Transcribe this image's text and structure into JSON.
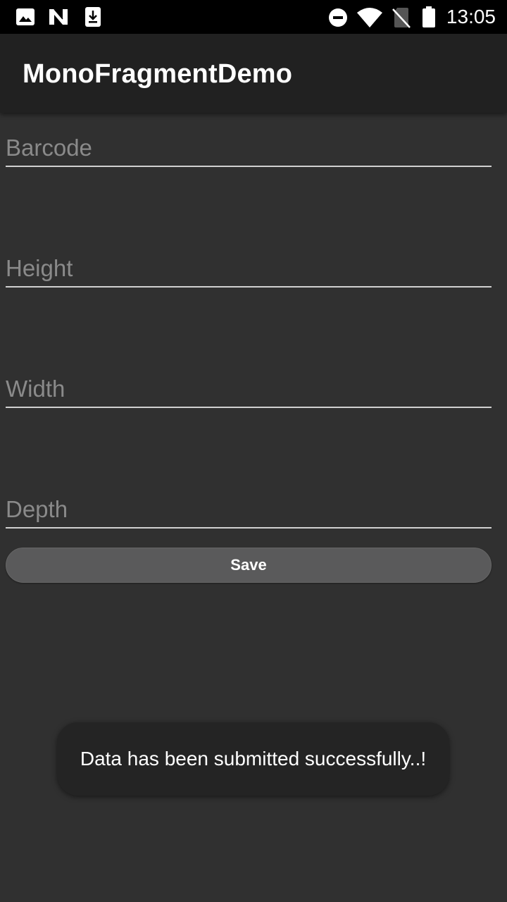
{
  "status_bar": {
    "time": "13:05",
    "left_icons": [
      "image-icon",
      "n-icon",
      "download-icon"
    ],
    "right_icons": [
      "do-not-disturb-icon",
      "wifi-icon",
      "no-sim-icon",
      "battery-icon"
    ]
  },
  "app_bar": {
    "title": "MonoFragmentDemo"
  },
  "form": {
    "barcode": {
      "placeholder": "Barcode",
      "value": ""
    },
    "height": {
      "placeholder": "Height",
      "value": ""
    },
    "width": {
      "placeholder": "Width",
      "value": ""
    },
    "depth": {
      "placeholder": "Depth",
      "value": ""
    },
    "save_label": "Save"
  },
  "toast": {
    "message": "Data has been submitted successfully..!"
  },
  "colors": {
    "background": "#303030",
    "app_bar": "#212121",
    "status_bar": "#000000",
    "button": "#5a5a5b",
    "toast": "#242424"
  }
}
